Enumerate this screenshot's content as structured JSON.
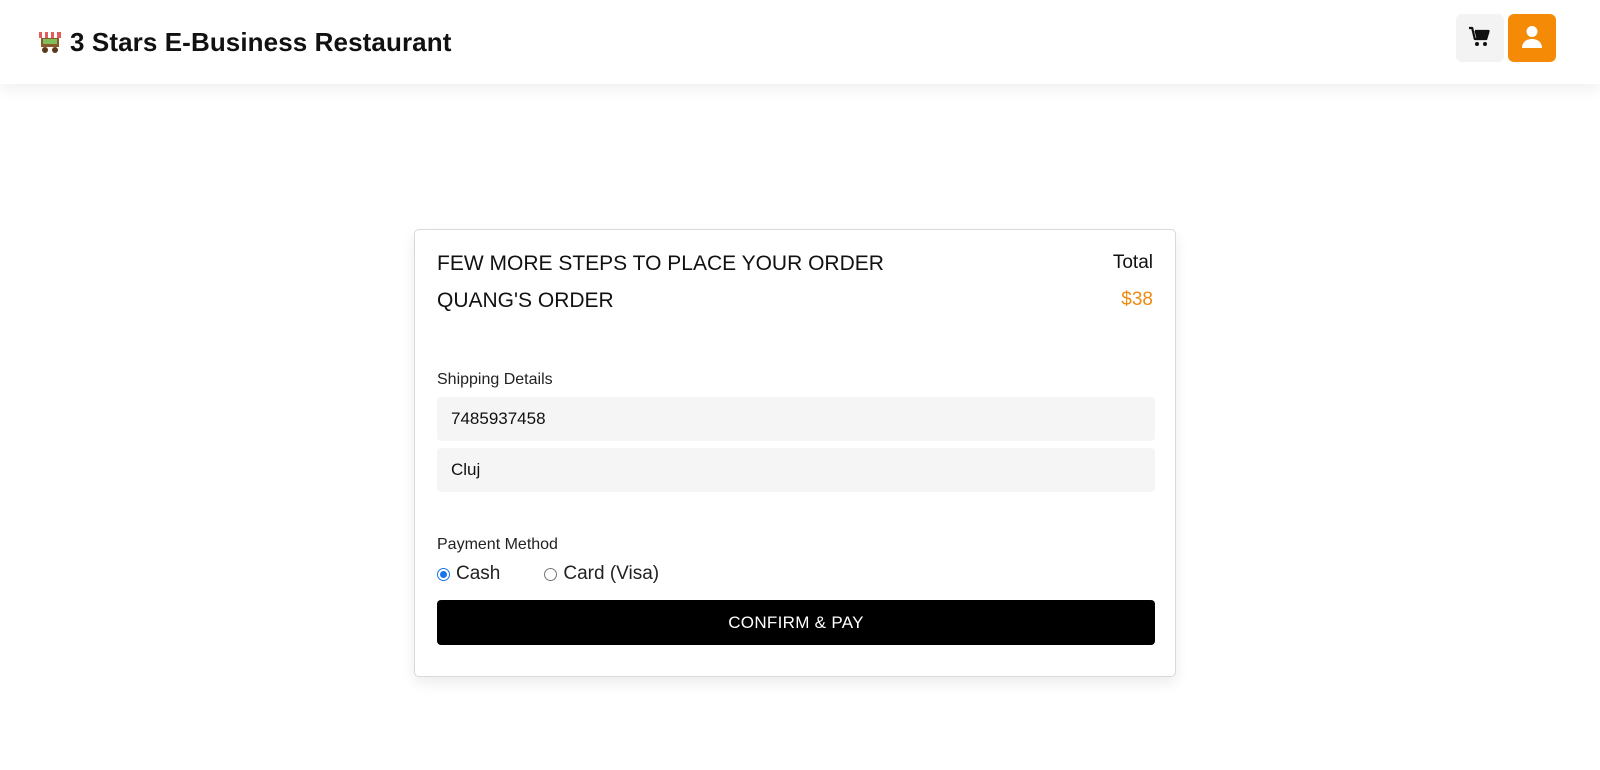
{
  "header": {
    "brand_title": "3 Stars E-Business Restaurant",
    "brand_icon": "food-cart-icon",
    "cart_icon": "cart-icon",
    "user_icon": "user-icon"
  },
  "order": {
    "heading": "FEW MORE STEPS TO PLACE YOUR ORDER",
    "subheading": "QUANG'S ORDER",
    "total_label": "Total",
    "total_value": "$38"
  },
  "shipping": {
    "label": "Shipping Details",
    "phone_value": "7485937458",
    "city_value": "Cluj"
  },
  "payment": {
    "label": "Payment Method",
    "options": [
      "Cash",
      "Card (Visa)"
    ],
    "selected": "Cash"
  },
  "actions": {
    "confirm_label": "CONFIRM & PAY"
  },
  "colors": {
    "accent": "#f58a07",
    "total_value": "#f08a10",
    "button_bg": "#000000",
    "radio_selected": "#1a73e8"
  }
}
